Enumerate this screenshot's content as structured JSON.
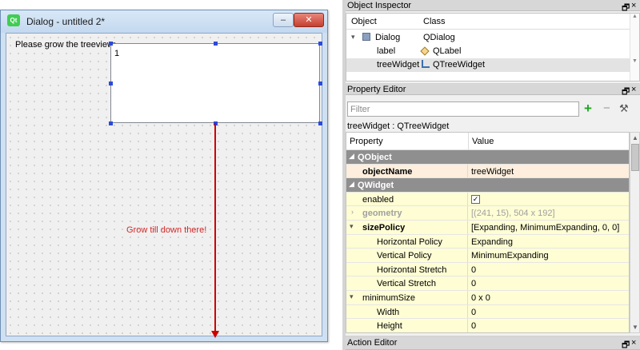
{
  "designer": {
    "dialog_title": "Dialog - untitled 2*",
    "label_text": "Please grow the treeview:",
    "tree_item": "1",
    "annotation": "Grow till down there!",
    "minimize_glyph": "–",
    "close_glyph": "✕"
  },
  "object_inspector": {
    "title": "Object Inspector",
    "col_object": "Object",
    "col_class": "Class",
    "rows": [
      {
        "object": "Dialog",
        "class": "QDialog"
      },
      {
        "object": "label",
        "class": "QLabel"
      },
      {
        "object": "treeWidget",
        "class": "QTreeWidget"
      }
    ]
  },
  "property_editor": {
    "title": "Property Editor",
    "filter_placeholder": "Filter",
    "class_line": "treeWidget : QTreeWidget",
    "col_property": "Property",
    "col_value": "Value",
    "rows": [
      {
        "name": "QObject",
        "value": ""
      },
      {
        "name": "objectName",
        "value": "treeWidget"
      },
      {
        "name": "QWidget",
        "value": ""
      },
      {
        "name": "enabled",
        "value": "✓"
      },
      {
        "name": "geometry",
        "value": "[(241, 15), 504 x 192]"
      },
      {
        "name": "sizePolicy",
        "value": "[Expanding, MinimumExpanding, 0, 0]"
      },
      {
        "name": "Horizontal Policy",
        "value": "Expanding"
      },
      {
        "name": "Vertical Policy",
        "value": "MinimumExpanding"
      },
      {
        "name": "Horizontal Stretch",
        "value": "0"
      },
      {
        "name": "Vertical Stretch",
        "value": "0"
      },
      {
        "name": "minimumSize",
        "value": "0 x 0"
      },
      {
        "name": "Width",
        "value": "0"
      },
      {
        "name": "Height",
        "value": "0"
      }
    ]
  },
  "action_editor": {
    "title": "Action Editor"
  },
  "dock_controls": {
    "float": "🗗",
    "close": "×"
  },
  "colors": {
    "selection_handle": "#2d4ad8",
    "annotation_red": "#cc0000",
    "group_header": "#8f8f8f",
    "changed_row": "#fdeedd",
    "property_row": "#fefdd4"
  }
}
